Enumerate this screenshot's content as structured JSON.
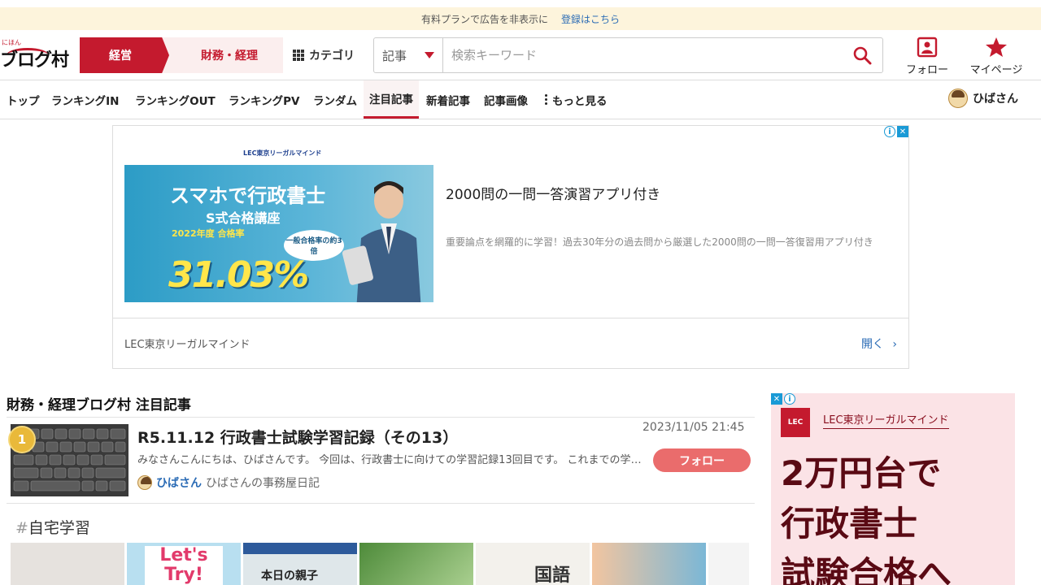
{
  "notice": {
    "text": "有料プランで広告を非表示に",
    "link": "登録はこちら"
  },
  "header": {
    "logo_small": "にほん",
    "logo_main": "ブログ村",
    "tab_primary": "経営",
    "tab_secondary": "財務・経理",
    "category_label": "カテゴリ",
    "search": {
      "select_value": "記事",
      "placeholder": "検索キーワード"
    },
    "follow_label": "フォロー",
    "mypage_label": "マイページ"
  },
  "nav": {
    "items": [
      "トップ",
      "ランキングIN",
      "ランキングOUT",
      "ランキングPV",
      "ランダム",
      "注目記事",
      "新着記事",
      "記事画像"
    ],
    "more_label": "もっと見る",
    "user_name": "ひばさん",
    "active_item": "注目記事"
  },
  "ad_top": {
    "brand_line": "LEC東京リーガルマインド",
    "banner_line1": "スマホで行政書士",
    "banner_line2": "S式合格講座",
    "banner_line3": "2022年度 合格率",
    "banner_rate": "31.03%",
    "banner_bubble": "一般合格率の約3倍",
    "title": "2000問の一問一答演習アプリ付き",
    "description": "重要論点を網羅的に学習！過去30年分の過去問から厳選した2000問の一問一答復習用アプリ付き",
    "advertiser": "LEC東京リーガルマインド",
    "open_label": "開く"
  },
  "section": {
    "title": "財務・経理ブログ村 注目記事",
    "article": {
      "rank": "1",
      "title": "R5.11.12 行政書士試験学習記録（その13）",
      "date": "2023/11/05 21:45",
      "excerpt": "みなさんこんにちは、ひばさんです。 今回は、行政書士に向けての学習記録13回目です。 これまでの学習記録",
      "author": "ひばさん",
      "blog": "ひばさんの事務屋日記",
      "follow_label": "フォロー"
    },
    "hashtag_mark": "#",
    "hashtag": "自宅学習",
    "strip_texts": [
      "",
      "Let's Try!",
      "本日の親子",
      "",
      "国語",
      "",
      ""
    ]
  },
  "ad_side": {
    "logo": "LEC",
    "advertiser": "LEC東京リーガルマインド",
    "copy_line1": "2万円台で",
    "copy_line2": "行政書士",
    "copy_line3": "試験合格へ"
  },
  "colors": {
    "accent": "#c41a2e",
    "link": "#2a6bb5",
    "follow_button": "#ea6c6c",
    "notice_bg": "#fdf4dc"
  }
}
